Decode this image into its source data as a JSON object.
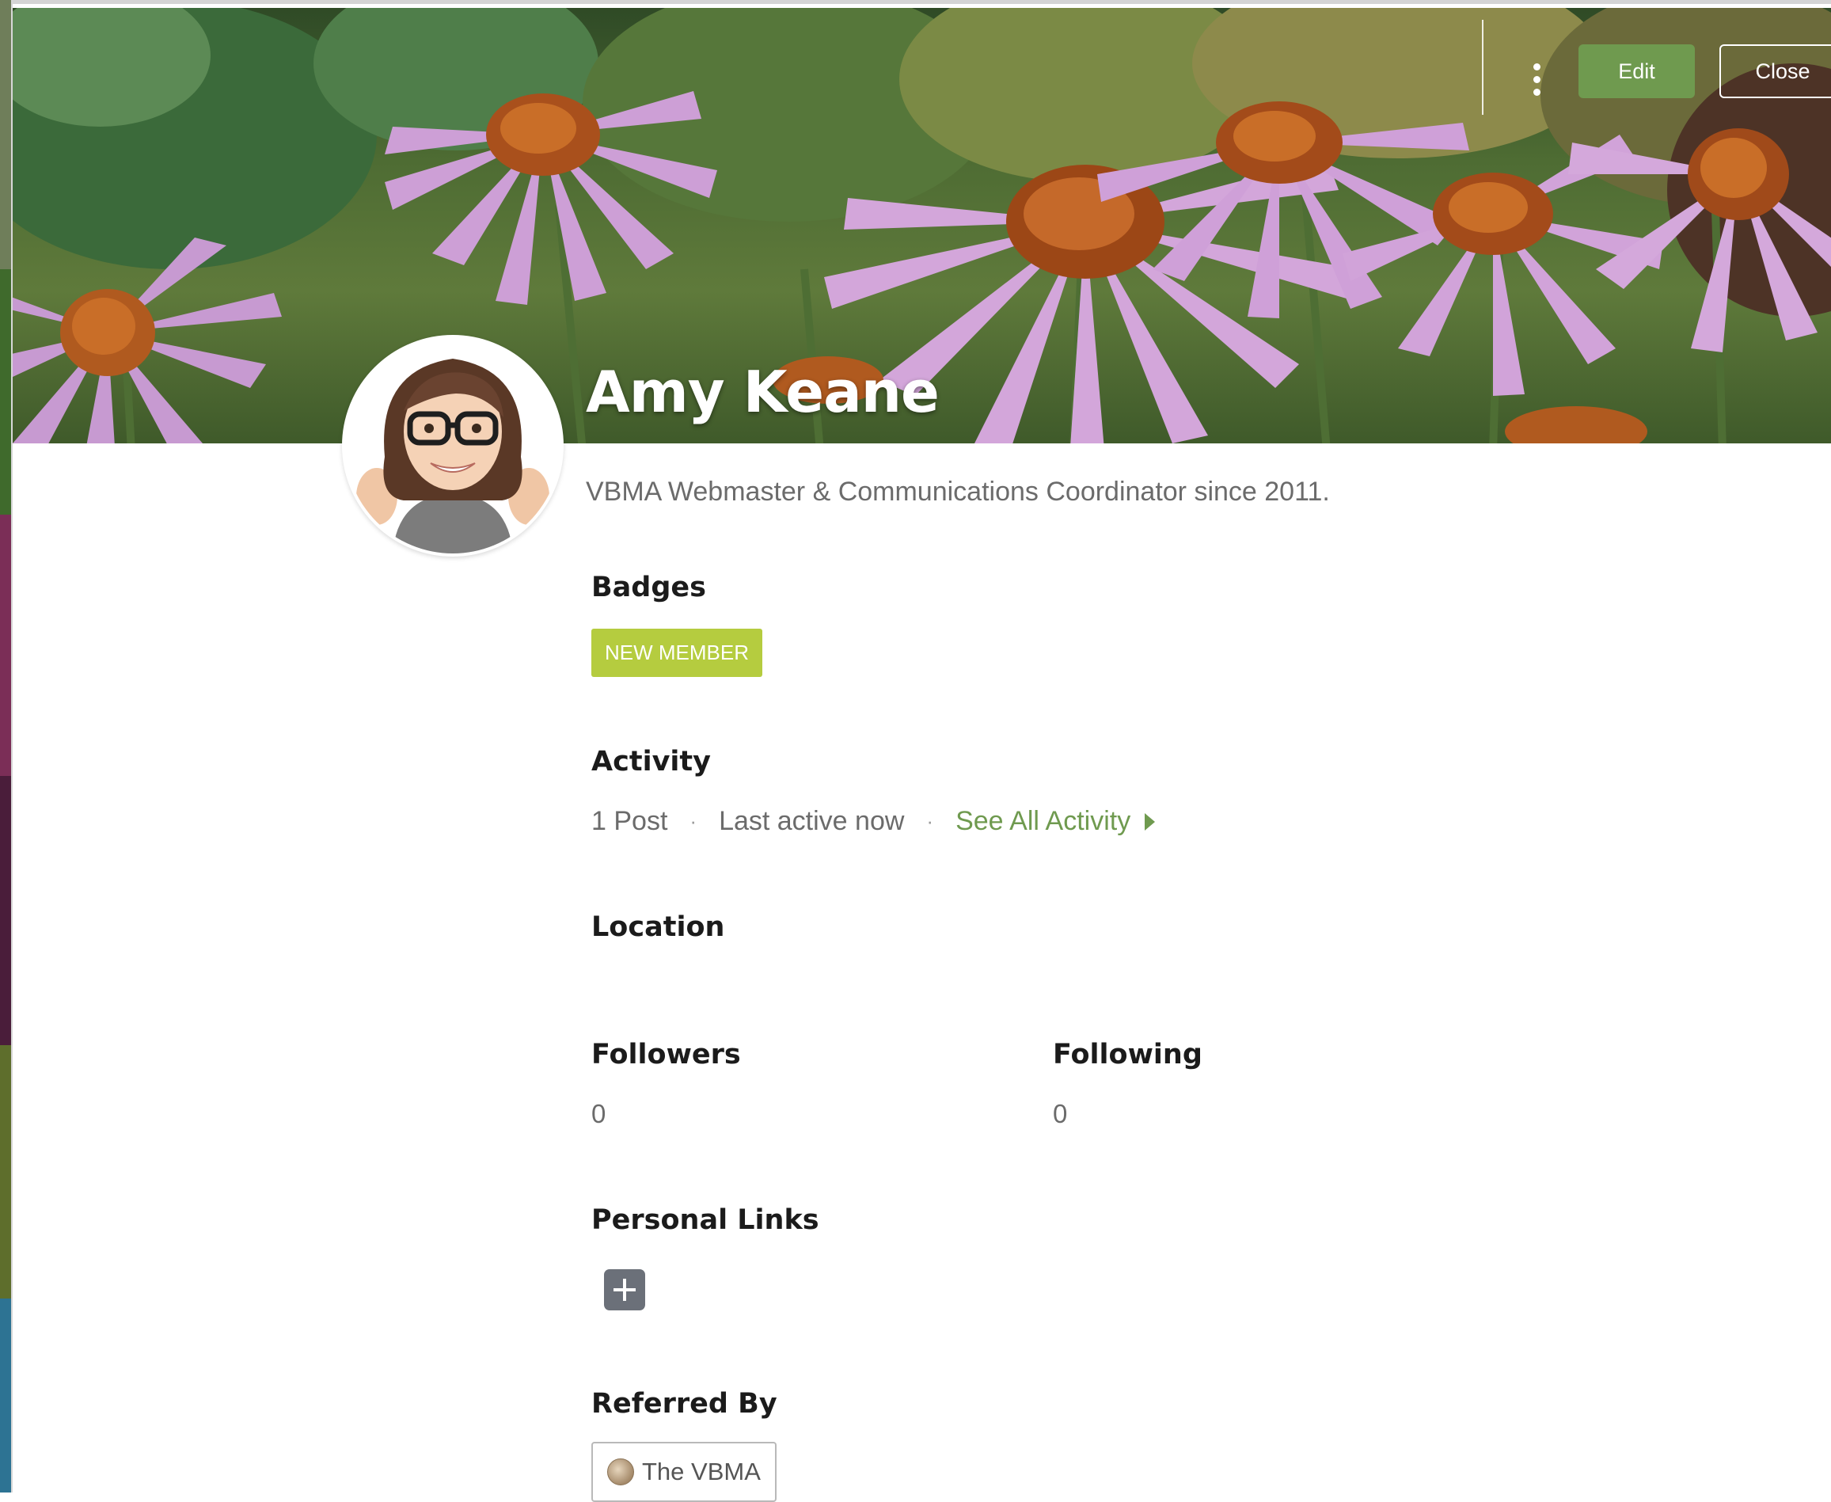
{
  "profile": {
    "name": "Amy Keane",
    "tagline": "VBMA Webmaster & Communications Coordinator since 2011."
  },
  "header": {
    "edit_label": "Edit",
    "close_label": "Close",
    "more_icon": "kebab-menu-icon"
  },
  "badges": {
    "title": "Badges",
    "items": [
      "NEW MEMBER"
    ]
  },
  "activity": {
    "title": "Activity",
    "posts": "1 Post",
    "separator": "·",
    "last_active": "Last active now",
    "see_all": "See All Activity"
  },
  "location": {
    "title": "Location"
  },
  "followers": {
    "title": "Followers",
    "count": "0"
  },
  "following": {
    "title": "Following",
    "count": "0"
  },
  "personal_links": {
    "title": "Personal Links",
    "add_icon": "plus-icon"
  },
  "referred_by": {
    "title": "Referred By",
    "name": "The VBMA"
  },
  "colors": {
    "accent_green": "#6f9a4f",
    "badge_green": "#b5cc3f",
    "muted_text": "#6b6b6b"
  }
}
